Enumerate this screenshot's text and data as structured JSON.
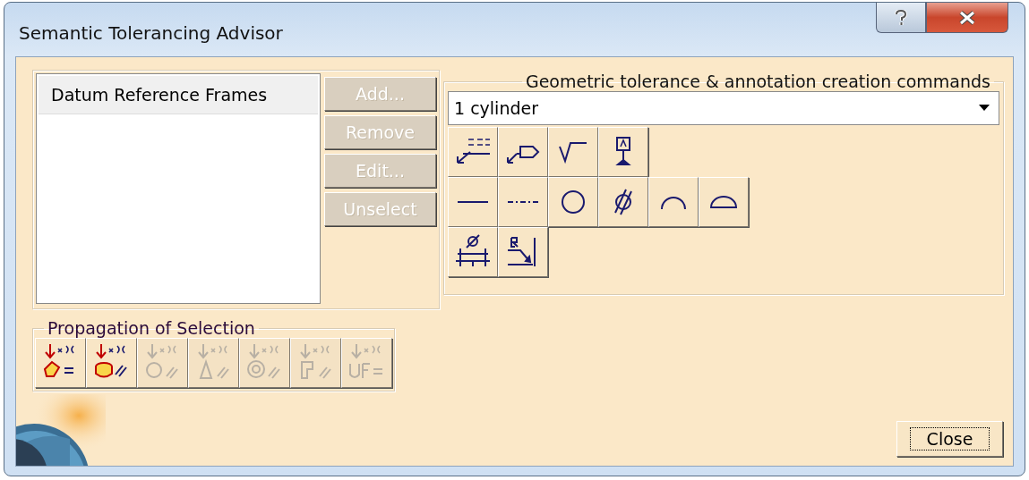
{
  "window": {
    "title": "Semantic Tolerancing Advisor"
  },
  "frames_list": {
    "header": "Datum Reference Frames"
  },
  "frame_buttons": [
    {
      "label": "Add...",
      "disabled": true
    },
    {
      "label": "Remove",
      "disabled": true
    },
    {
      "label": "Edit...",
      "disabled": true
    },
    {
      "label": "Unselect",
      "disabled": true
    }
  ],
  "commands": {
    "title": "Geometric tolerance & annotation creation commands",
    "dropdown_value": "1 cylinder",
    "rows": [
      [
        {
          "kind": "leader-text"
        },
        {
          "kind": "flag-note"
        },
        {
          "kind": "roughness"
        },
        {
          "kind": "datum-target"
        }
      ],
      [
        {
          "kind": "straightness"
        },
        {
          "kind": "dash-line"
        },
        {
          "kind": "circle"
        },
        {
          "kind": "cylindricity"
        },
        {
          "kind": "arc"
        },
        {
          "kind": "half-circle"
        }
      ],
      [
        {
          "kind": "diameter"
        },
        {
          "kind": "radius"
        }
      ]
    ]
  },
  "propagation": {
    "title": "Propagation of Selection",
    "buttons": [
      {
        "kind": "face",
        "disabled": false
      },
      {
        "kind": "solid",
        "disabled": false
      },
      {
        "kind": "circle",
        "disabled": true
      },
      {
        "kind": "cone",
        "disabled": true
      },
      {
        "kind": "rings",
        "disabled": true
      },
      {
        "kind": "part",
        "disabled": true
      },
      {
        "kind": "uf",
        "disabled": true
      }
    ]
  },
  "close_label": "Close"
}
